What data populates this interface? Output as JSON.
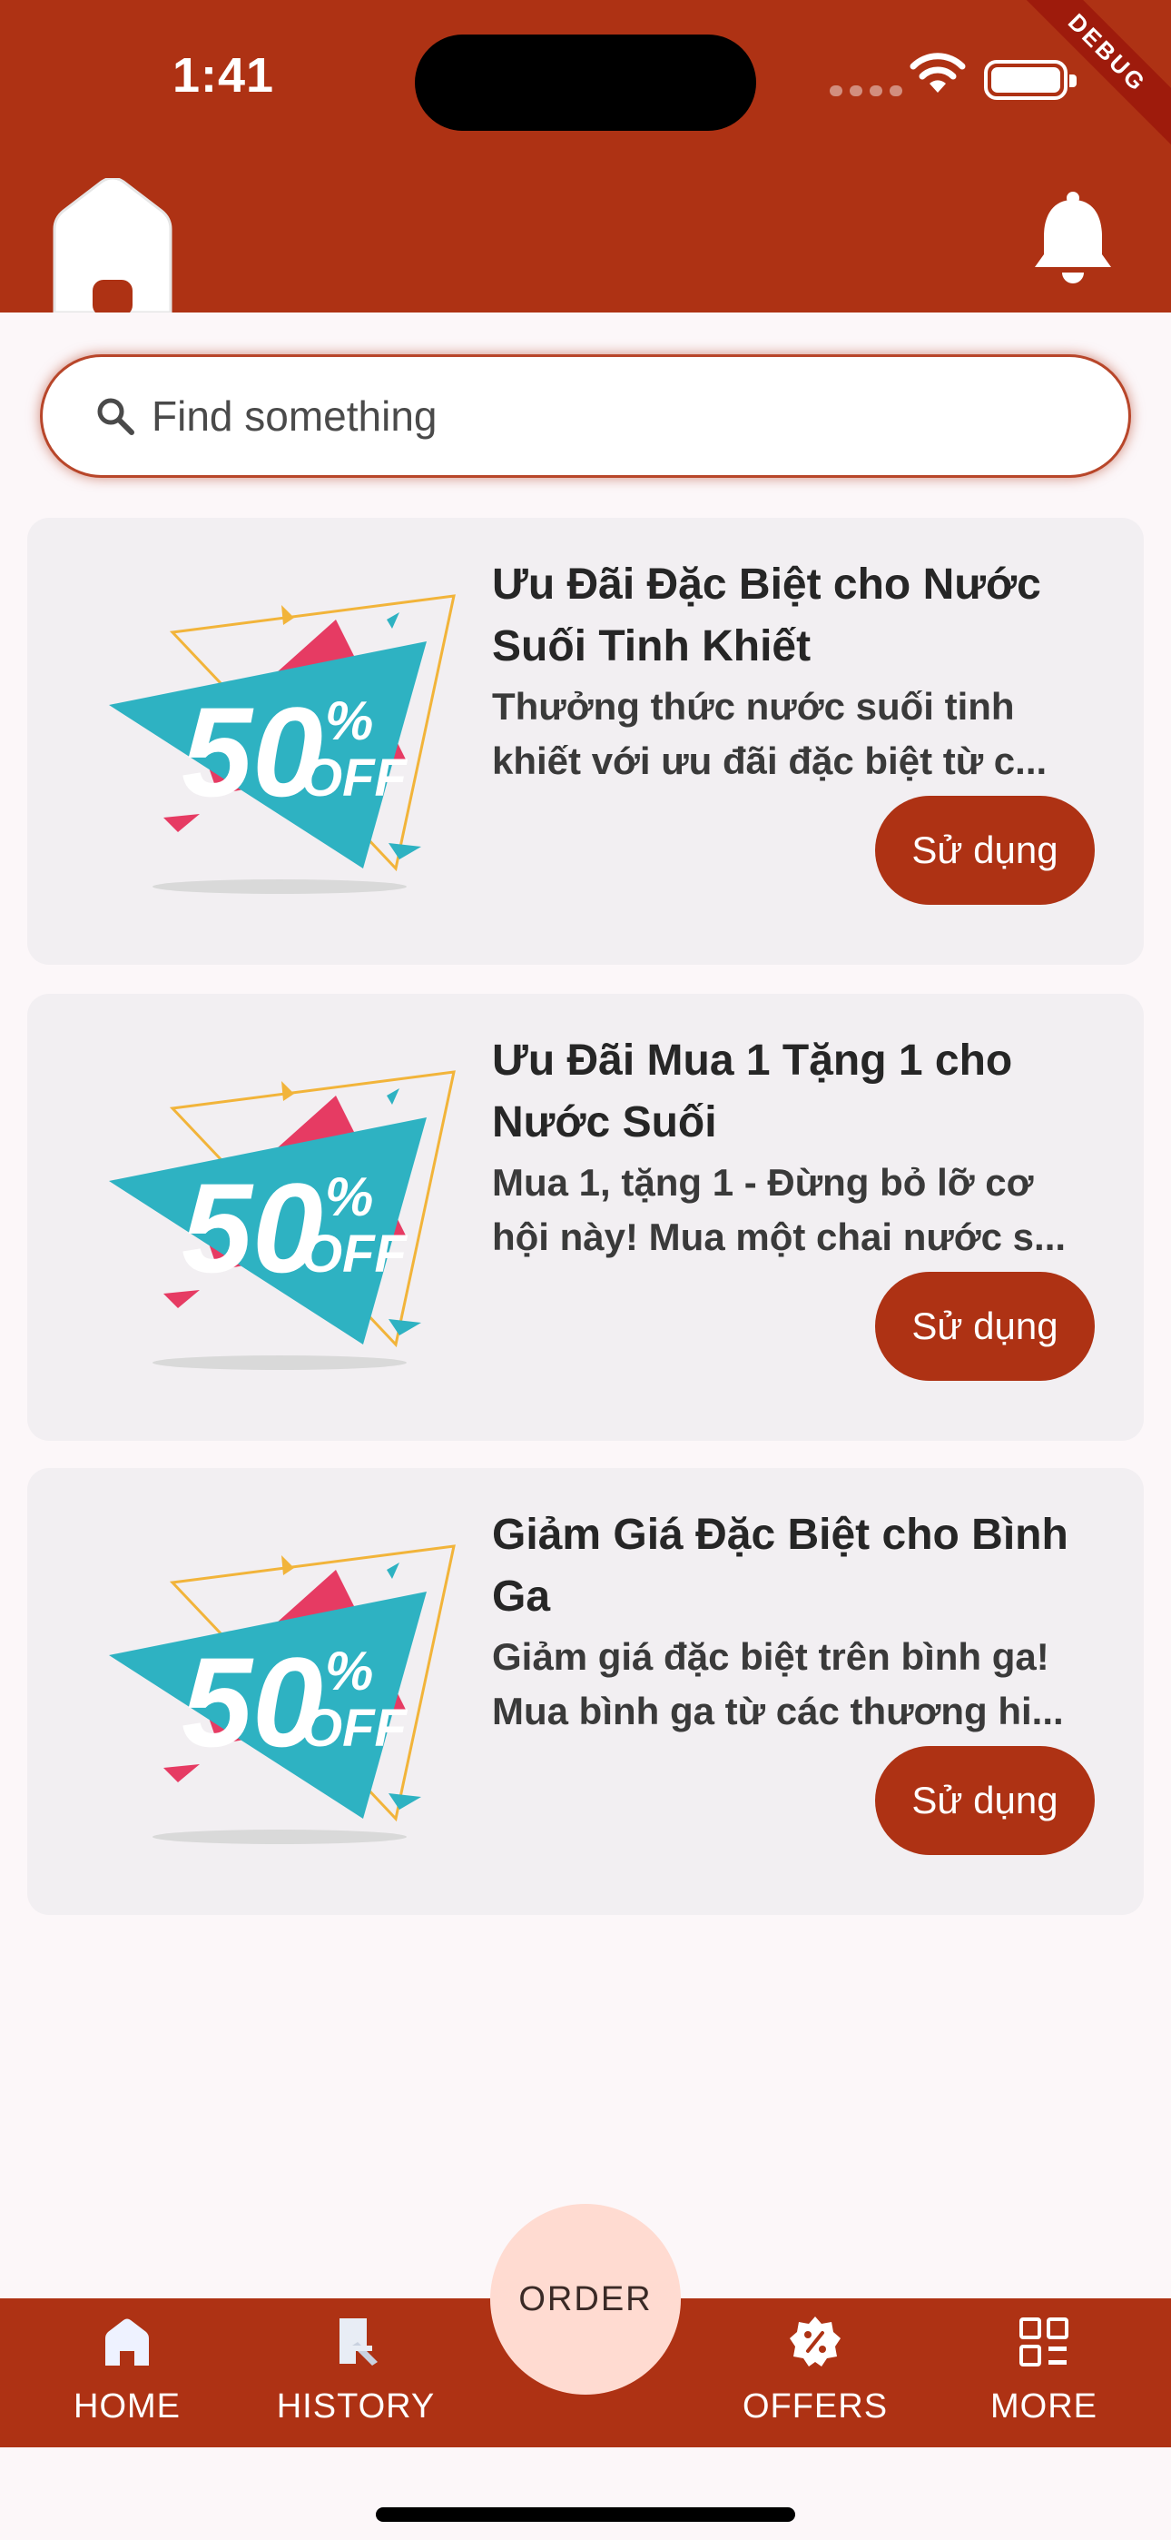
{
  "status_bar": {
    "time": "1:41",
    "debug_label": "DEBUG"
  },
  "app_bar": {
    "home_icon": "home-icon",
    "bell_icon": "bell-icon"
  },
  "search": {
    "placeholder": "Find something",
    "icon": "search-icon"
  },
  "offers": [
    {
      "badge_icon": "50-percent-off-badge",
      "title_lines": [
        "Ưu Đãi Đặc Biệt cho Nước",
        "Suối Tinh Khiết"
      ],
      "desc_lines": [
        "Thưởng thức nước suối tinh",
        "khiết với ưu đãi đặc biệt từ c..."
      ],
      "button": "Sử dụng"
    },
    {
      "badge_icon": "50-percent-off-badge",
      "title_lines": [
        "Ưu Đãi Mua 1 Tặng 1 cho",
        "Nước Suối"
      ],
      "desc_lines": [
        "Mua 1, tặng 1 - Đừng bỏ lỡ cơ",
        "hội này! Mua một chai nước s..."
      ],
      "button": "Sử dụng"
    },
    {
      "badge_icon": "50-percent-off-badge",
      "title_lines": [
        "Giảm Giá Đặc Biệt cho Bình",
        "Ga"
      ],
      "desc_lines": [
        "Giảm giá đặc biệt trên bình ga!",
        "Mua bình ga từ các thương hi..."
      ],
      "button": "Sử dụng"
    }
  ],
  "badge": {
    "number": "50",
    "percent": "%",
    "off": "OFF"
  },
  "bottom_nav": {
    "items": [
      {
        "label": "HOME",
        "icon": "home-icon"
      },
      {
        "label": "HISTORY",
        "icon": "history-icon"
      },
      {
        "label": "OFFERS",
        "icon": "offers-icon"
      },
      {
        "label": "MORE",
        "icon": "more-icon"
      }
    ],
    "center": "ORDER"
  },
  "colors": {
    "primary": "#AE3214",
    "card": "#F2EFF2",
    "background": "#FCF7F9",
    "order": "#FFDBD1"
  }
}
